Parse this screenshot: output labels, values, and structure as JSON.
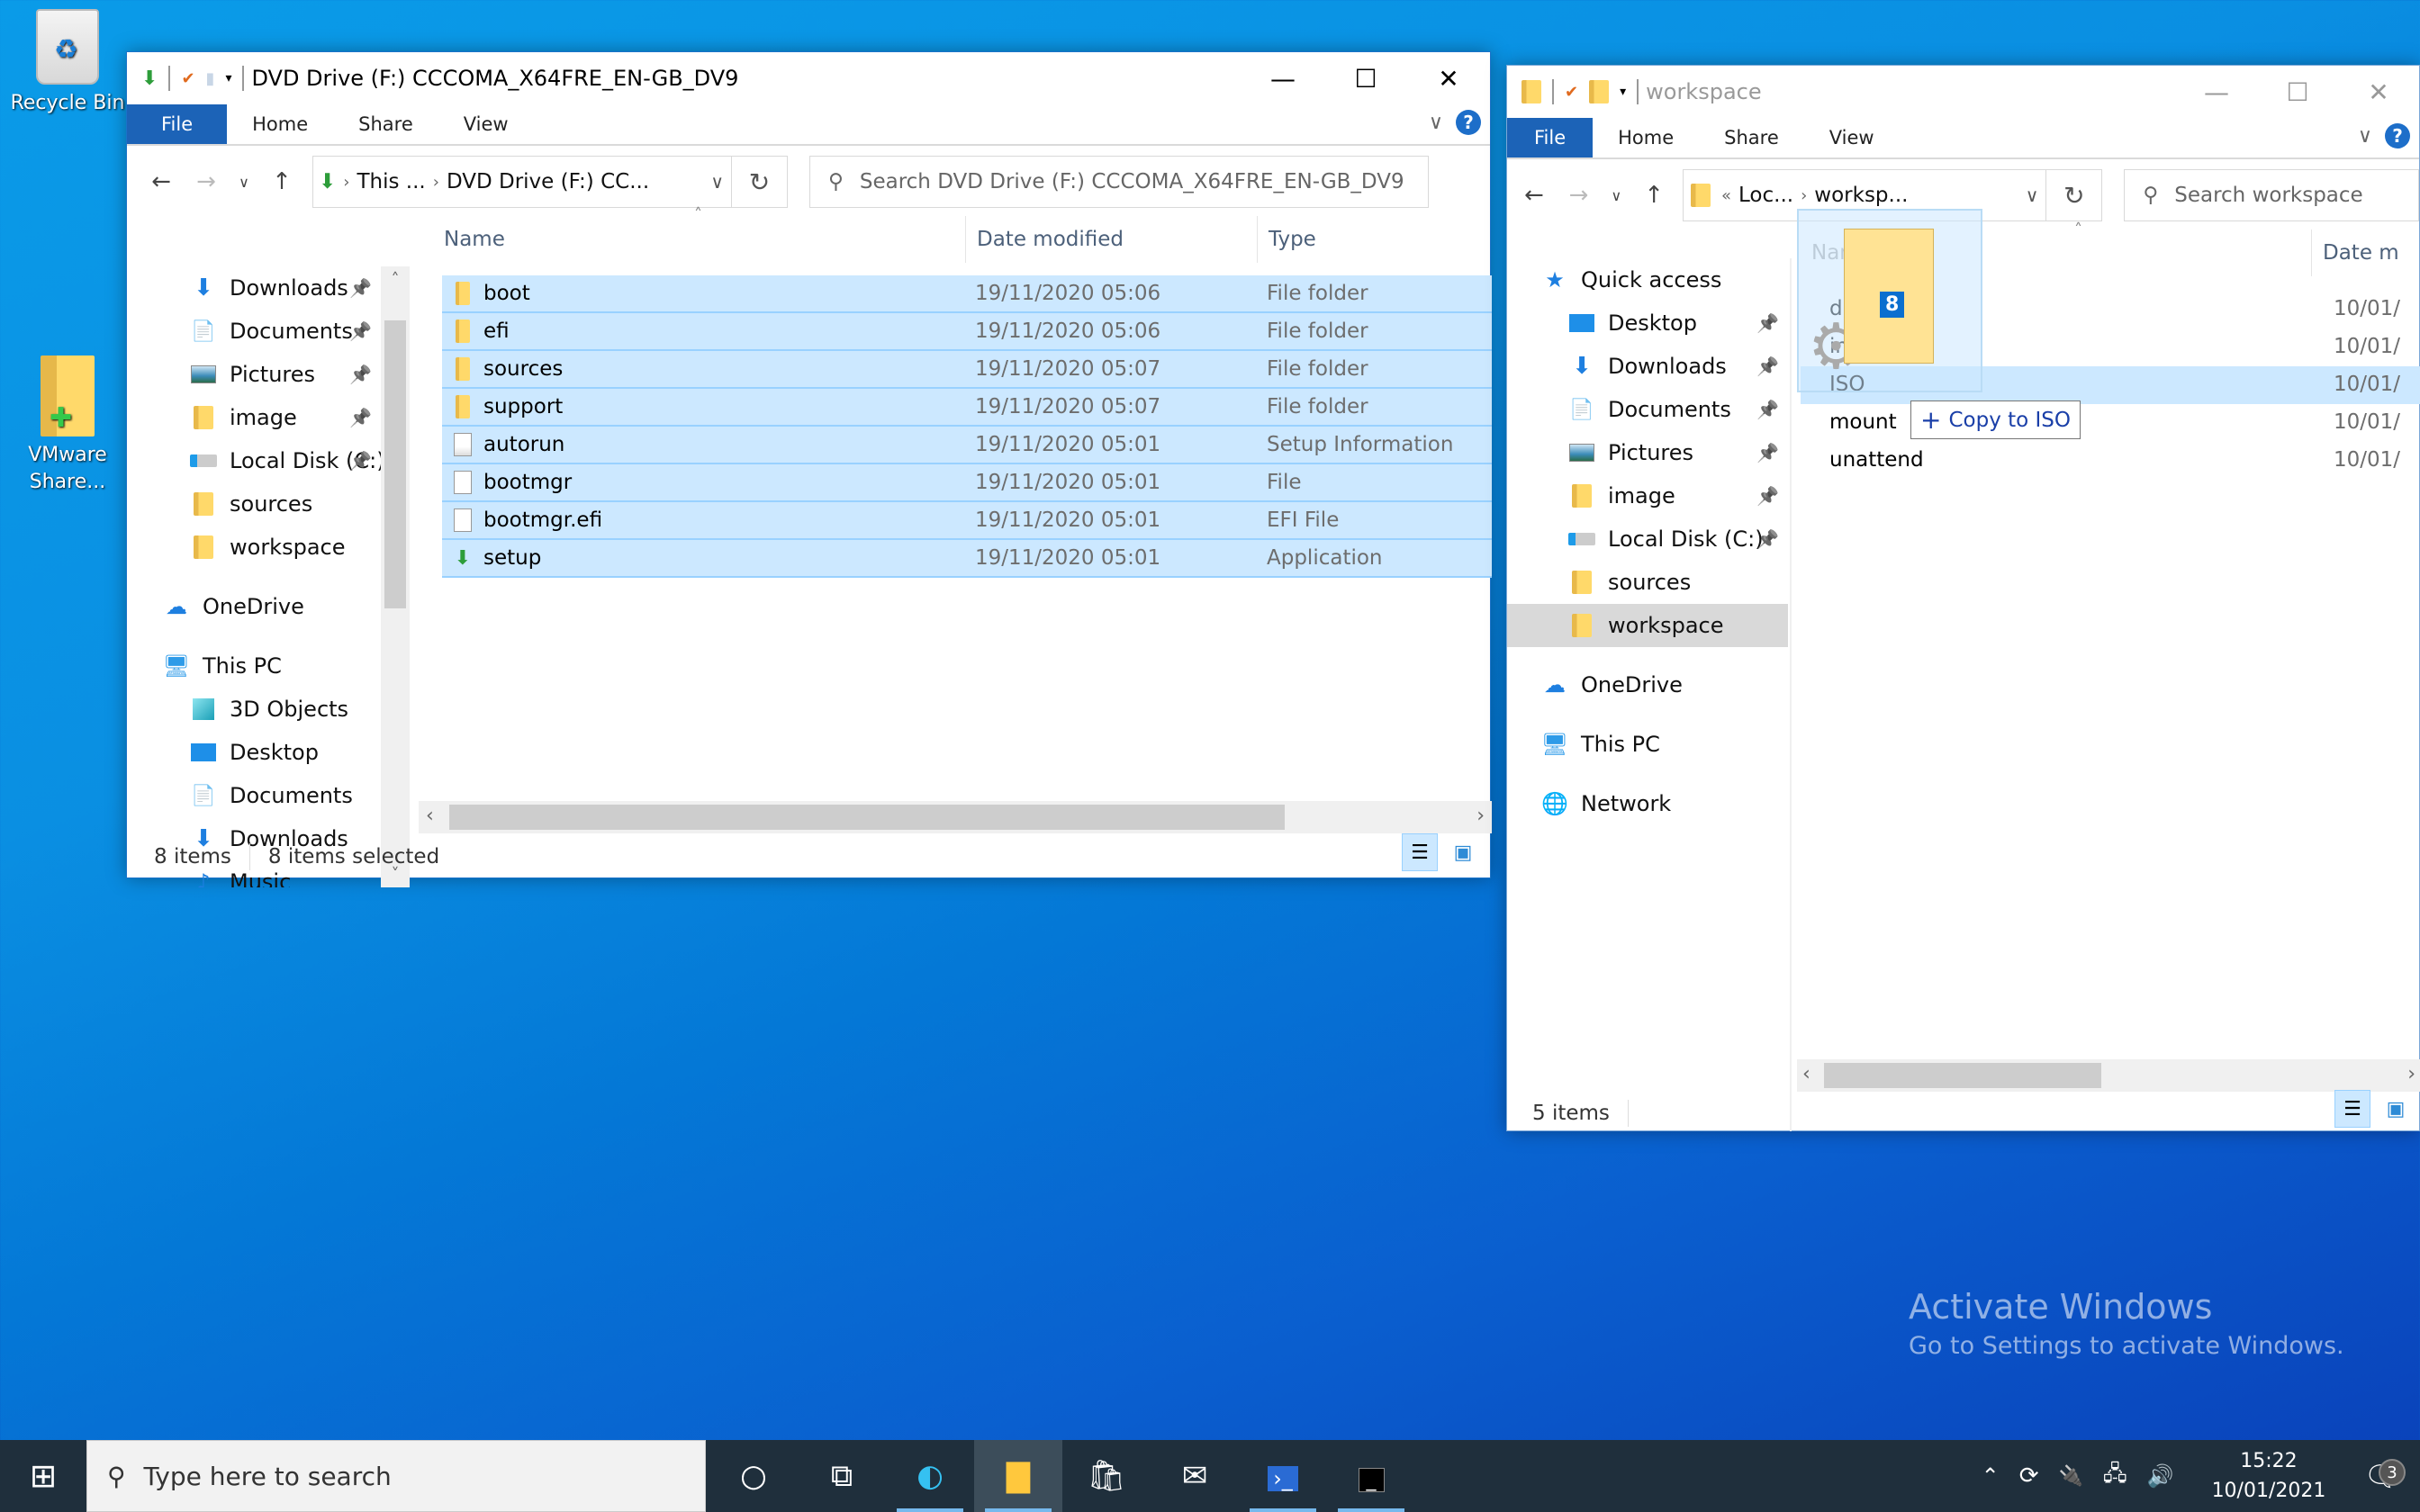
{
  "desktop": {
    "icons": [
      {
        "label": "Recycle Bin",
        "icon": "recycle-bin-icon"
      },
      {
        "label": "VMware Share...",
        "icon": "vmware-shared-folder-icon"
      }
    ],
    "watermark": {
      "title": "Activate Windows",
      "subtitle": "Go to Settings to activate Windows."
    }
  },
  "left_window": {
    "title": "DVD Drive (F:) CCCOMA_X64FRE_EN-GB_DV9",
    "ribbon_tabs": [
      "File",
      "Home",
      "Share",
      "View"
    ],
    "address": {
      "crumbs": [
        "This ...",
        "DVD Drive (F:) CC..."
      ]
    },
    "search_placeholder": "Search DVD Drive (F:) CCCOMA_X64FRE_EN-GB_DV9",
    "sidebar": [
      {
        "label": "Downloads",
        "icon": "downloads-icon",
        "pinned": true,
        "indent": 1
      },
      {
        "label": "Documents",
        "icon": "documents-icon",
        "pinned": true,
        "indent": 1
      },
      {
        "label": "Pictures",
        "icon": "pictures-icon",
        "pinned": true,
        "indent": 1
      },
      {
        "label": "image",
        "icon": "folder-icon",
        "pinned": true,
        "indent": 1
      },
      {
        "label": "Local Disk (C:)",
        "icon": "local-disk-icon",
        "pinned": true,
        "indent": 1
      },
      {
        "label": "sources",
        "icon": "folder-icon",
        "pinned": false,
        "indent": 1
      },
      {
        "label": "workspace",
        "icon": "folder-icon",
        "pinned": false,
        "indent": 1
      },
      {
        "label": "OneDrive",
        "icon": "onedrive-icon",
        "pinned": false,
        "indent": 0
      },
      {
        "label": "This PC",
        "icon": "this-pc-icon",
        "pinned": false,
        "indent": 0
      },
      {
        "label": "3D Objects",
        "icon": "3d-objects-icon",
        "pinned": false,
        "indent": 1
      },
      {
        "label": "Desktop",
        "icon": "desktop-icon",
        "pinned": false,
        "indent": 1
      },
      {
        "label": "Documents",
        "icon": "documents-icon",
        "pinned": false,
        "indent": 1
      },
      {
        "label": "Downloads",
        "icon": "downloads-icon",
        "pinned": false,
        "indent": 1
      },
      {
        "label": "Music",
        "icon": "music-icon",
        "pinned": false,
        "indent": 1
      }
    ],
    "columns": [
      "Name",
      "Date modified",
      "Type"
    ],
    "files": [
      {
        "name": "boot",
        "date": "19/11/2020 05:06",
        "type": "File folder",
        "icon": "folder-icon"
      },
      {
        "name": "efi",
        "date": "19/11/2020 05:06",
        "type": "File folder",
        "icon": "folder-icon"
      },
      {
        "name": "sources",
        "date": "19/11/2020 05:07",
        "type": "File folder",
        "icon": "folder-icon"
      },
      {
        "name": "support",
        "date": "19/11/2020 05:07",
        "type": "File folder",
        "icon": "folder-icon"
      },
      {
        "name": "autorun",
        "date": "19/11/2020 05:01",
        "type": "Setup Information",
        "icon": "setup-info-icon"
      },
      {
        "name": "bootmgr",
        "date": "19/11/2020 05:01",
        "type": "File",
        "icon": "file-icon"
      },
      {
        "name": "bootmgr.efi",
        "date": "19/11/2020 05:01",
        "type": "EFI File",
        "icon": "file-icon"
      },
      {
        "name": "setup",
        "date": "19/11/2020 05:01",
        "type": "Application",
        "icon": "setup-app-icon"
      }
    ],
    "status": {
      "count": "8 items",
      "selected": "8 items selected"
    }
  },
  "right_window": {
    "title": "workspace",
    "ribbon_tabs": [
      "File",
      "Home",
      "Share",
      "View"
    ],
    "address": {
      "prefix": "«",
      "crumbs": [
        "Loc...",
        "worksp..."
      ]
    },
    "search_placeholder": "Search workspace",
    "sidebar": [
      {
        "label": "Quick access",
        "icon": "quick-access-icon",
        "pinned": false,
        "indent": 0
      },
      {
        "label": "Desktop",
        "icon": "desktop-icon",
        "pinned": true,
        "indent": 1
      },
      {
        "label": "Downloads",
        "icon": "downloads-icon",
        "pinned": true,
        "indent": 1
      },
      {
        "label": "Documents",
        "icon": "documents-icon",
        "pinned": true,
        "indent": 1
      },
      {
        "label": "Pictures",
        "icon": "pictures-icon",
        "pinned": true,
        "indent": 1
      },
      {
        "label": "image",
        "icon": "folder-icon",
        "pinned": true,
        "indent": 1
      },
      {
        "label": "Local Disk (C:)",
        "icon": "local-disk-icon",
        "pinned": true,
        "indent": 1
      },
      {
        "label": "sources",
        "icon": "folder-icon",
        "pinned": false,
        "indent": 1
      },
      {
        "label": "workspace",
        "icon": "folder-icon",
        "pinned": false,
        "indent": 1,
        "selected": true
      },
      {
        "label": "OneDrive",
        "icon": "onedrive-icon",
        "pinned": false,
        "indent": 0
      },
      {
        "label": "This PC",
        "icon": "this-pc-icon",
        "pinned": false,
        "indent": 0
      },
      {
        "label": "Network",
        "icon": "network-icon",
        "pinned": false,
        "indent": 0
      }
    ],
    "columns": [
      "Name",
      "Date m"
    ],
    "files": [
      {
        "name": "drivers",
        "date": "10/01/",
        "highlight": false
      },
      {
        "name": "image",
        "date": "10/01/",
        "highlight": false
      },
      {
        "name": "ISO",
        "date": "10/01/",
        "highlight": true
      },
      {
        "name": "mount",
        "date": "10/01/",
        "highlight": false
      },
      {
        "name": "unattend",
        "date": "10/01/",
        "highlight": false
      }
    ],
    "status": {
      "count": "5 items"
    }
  },
  "drag": {
    "count": "8",
    "tooltip": "Copy to ISO"
  },
  "taskbar": {
    "search_placeholder": "Type here to search",
    "apps": [
      {
        "name": "cortana",
        "icon": "cortana-icon"
      },
      {
        "name": "task-view",
        "icon": "task-view-icon"
      },
      {
        "name": "edge",
        "icon": "edge-icon"
      },
      {
        "name": "file-explorer",
        "icon": "file-explorer-icon",
        "active": true
      },
      {
        "name": "store",
        "icon": "store-icon"
      },
      {
        "name": "mail",
        "icon": "mail-icon"
      },
      {
        "name": "powershell",
        "icon": "powershell-icon"
      },
      {
        "name": "command-prompt",
        "icon": "cmd-icon"
      }
    ],
    "time": "15:22",
    "date": "10/01/2021",
    "notification_count": "3"
  }
}
